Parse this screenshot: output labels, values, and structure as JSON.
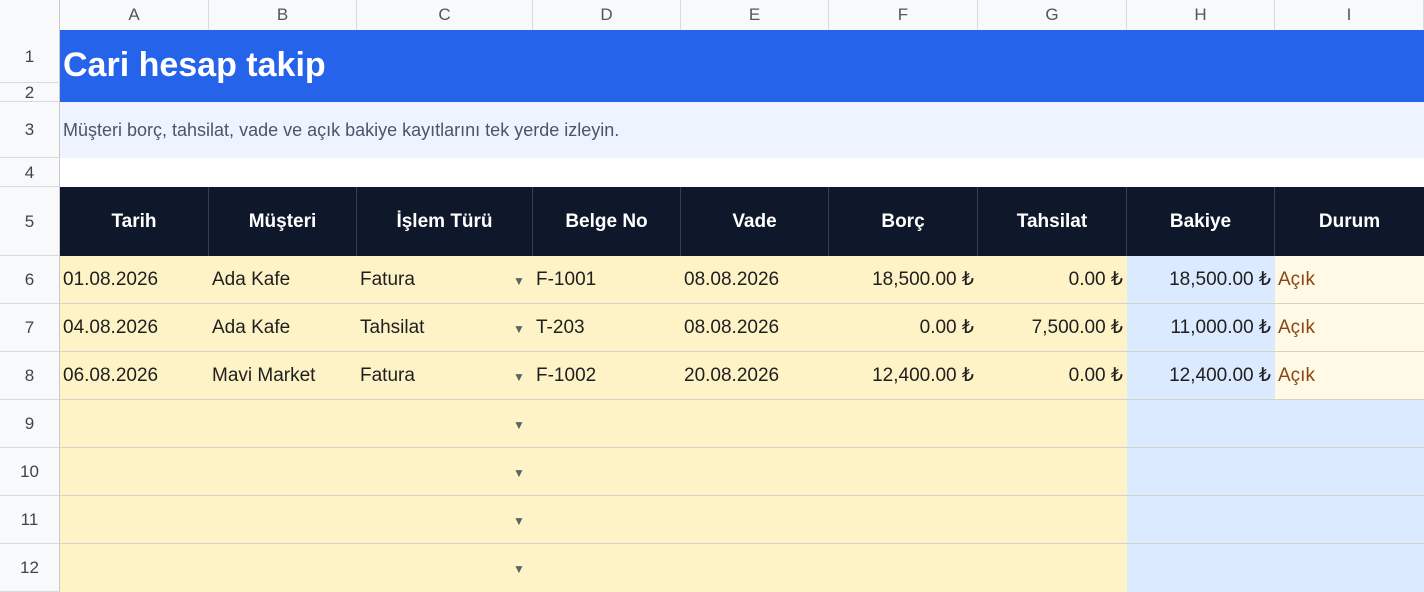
{
  "columns": [
    "A",
    "B",
    "C",
    "D",
    "E",
    "F",
    "G",
    "H",
    "I"
  ],
  "rows": [
    "1",
    "2",
    "3",
    "4",
    "5",
    "6",
    "7",
    "8",
    "9",
    "10",
    "11",
    "12"
  ],
  "title": "Cari hesap takip",
  "subtitle": "Müşteri borç, tahsilat, vade ve açık bakiye kayıtlarını tek yerde izleyin.",
  "headers": [
    "Tarih",
    "Müşteri",
    "İşlem Türü",
    "Belge No",
    "Vade",
    "Borç",
    "Tahsilat",
    "Bakiye",
    "Durum"
  ],
  "records": [
    {
      "tarih": "01.08.2026",
      "musteri": "Ada Kafe",
      "islem": "Fatura",
      "belge": "F-1001",
      "vade": "08.08.2026",
      "borc": "18,500.00 ₺",
      "tahsilat": "0.00 ₺",
      "bakiye": "18,500.00 ₺",
      "durum": "Açık"
    },
    {
      "tarih": "04.08.2026",
      "musteri": "Ada Kafe",
      "islem": "Tahsilat",
      "belge": "T-203",
      "vade": "08.08.2026",
      "borc": "0.00 ₺",
      "tahsilat": "7,500.00 ₺",
      "bakiye": "11,000.00 ₺",
      "durum": "Açık"
    },
    {
      "tarih": "06.08.2026",
      "musteri": "Mavi Market",
      "islem": "Fatura",
      "belge": "F-1002",
      "vade": "20.08.2026",
      "borc": "12,400.00 ₺",
      "tahsilat": "0.00 ₺",
      "bakiye": "12,400.00 ₺",
      "durum": "Açık"
    }
  ],
  "dropdown_icon": "chevron-down-icon",
  "colors": {
    "title_bg": "#2563eb",
    "header_bg": "#0f172a",
    "input_bg": "#fef3c7",
    "balance_bg": "#dbeafe",
    "status_text": "#8b4513"
  }
}
